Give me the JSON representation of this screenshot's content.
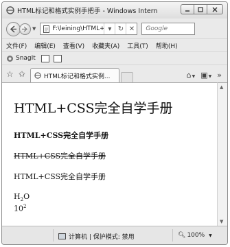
{
  "window": {
    "title": "HTML标记和格式实例手把手 - Windows Internet..."
  },
  "nav": {
    "address": "F:\\leining\\HTML+",
    "search_placeholder": "Google"
  },
  "menu": {
    "items": [
      "文件(F)",
      "编辑(E)",
      "查看(V)",
      "收藏夹(A)",
      "工具(T)",
      "帮助(H)"
    ]
  },
  "snagit": {
    "label": "SnagIt"
  },
  "tab": {
    "label": "HTML标记和格式实例..."
  },
  "content": {
    "heading": "HTML+CSS完全自学手册",
    "bold_line": "HTML+CSS完全自学手册",
    "strike_line": "HTML+CSS完全自学手册",
    "plain_line": "HTML+CSS完全自学手册",
    "formula1_base": "H",
    "formula1_sub": "2",
    "formula1_tail": "O",
    "formula2_base": "10",
    "formula2_sup": "2"
  },
  "status": {
    "zone": "计算机 | 保护模式: 禁用",
    "zoom": "100%"
  },
  "icons": {
    "back": "back-arrow-icon",
    "forward": "forward-arrow-icon",
    "refresh": "refresh-icon",
    "stop": "stop-icon",
    "favorites": "favorites-star-icon",
    "add_favorites": "add-favorites-icon",
    "home": "home-icon",
    "feeds": "feeds-icon",
    "computer": "computer-icon",
    "zoom": "magnifier-icon"
  }
}
